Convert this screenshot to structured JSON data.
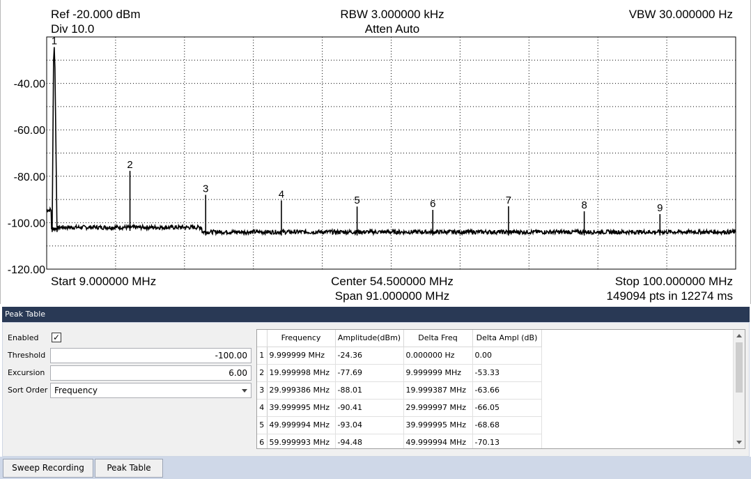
{
  "display": {
    "ref": "Ref -20.000 dBm",
    "div": "Div 10.0",
    "rbw": "RBW 3.000000 kHz",
    "atten": "Atten Auto",
    "vbw": "VBW 30.000000 Hz",
    "start": "Start 9.000000 MHz",
    "center": "Center 54.500000 MHz",
    "span": "Span 91.000000 MHz",
    "stop": "Stop 100.000000 MHz",
    "points": "149094 pts in 12274 ms"
  },
  "chart_data": {
    "type": "line",
    "xlim": [
      9,
      100
    ],
    "ylim": [
      -120,
      -20
    ],
    "grid": true,
    "y_tick_labels": [
      "-40.00",
      "-60.00",
      "-80.00",
      "-100.00",
      "-120.00"
    ],
    "y_ticks": [
      -40,
      -60,
      -80,
      -100,
      -120
    ],
    "trace_color": "#000000",
    "noise_floor": [
      {
        "x": [
          9.0,
          9.6
        ],
        "y": -94.5
      },
      {
        "x": [
          9.6,
          10.5
        ],
        "y": -102.5
      },
      {
        "x": [
          10.5,
          29.5
        ],
        "y": -102.0
      },
      {
        "x": [
          29.5,
          100.0
        ],
        "y": -104.0
      }
    ],
    "markers": [
      {
        "label": "1",
        "x": 9.999999,
        "y": -24.36
      },
      {
        "label": "2",
        "x": 19.999998,
        "y": -77.69
      },
      {
        "label": "3",
        "x": 29.999386,
        "y": -88.01
      },
      {
        "label": "4",
        "x": 39.999995,
        "y": -90.41
      },
      {
        "label": "5",
        "x": 49.999994,
        "y": -93.04
      },
      {
        "label": "6",
        "x": 59.999993,
        "y": -94.48
      },
      {
        "label": "7",
        "x": 69.999992,
        "y": -92.9
      },
      {
        "label": "8",
        "x": 79.999991,
        "y": -95.1
      },
      {
        "label": "9",
        "x": 89.99999,
        "y": -96.3
      }
    ]
  },
  "panel": {
    "title": "Peak Table",
    "enabled_label": "Enabled",
    "enabled_check": "✓",
    "threshold_label": "Threshold",
    "threshold_value": "-100.00",
    "excursion_label": "Excursion",
    "excursion_value": "6.00",
    "sort_label": "Sort Order",
    "sort_value": "Frequency"
  },
  "table": {
    "headers": [
      "Frequency",
      "Amplitude(dBm)",
      "Delta Freq",
      "Delta Ampl (dB)"
    ],
    "rows": [
      [
        "1",
        "9.999999 MHz",
        "-24.36",
        "0.000000 Hz",
        "0.00"
      ],
      [
        "2",
        "19.999998 MHz",
        "-77.69",
        "9.999999 MHz",
        "-53.33"
      ],
      [
        "3",
        "29.999386 MHz",
        "-88.01",
        "19.999387 MHz",
        "-63.66"
      ],
      [
        "4",
        "39.999995 MHz",
        "-90.41",
        "29.999997 MHz",
        "-66.05"
      ],
      [
        "5",
        "49.999994 MHz",
        "-93.04",
        "39.999995 MHz",
        "-68.68"
      ],
      [
        "6",
        "59.999993 MHz",
        "-94.48",
        "49.999994 MHz",
        "-70.13"
      ]
    ]
  },
  "tabs": [
    "Sweep Recording",
    "Peak Table"
  ]
}
